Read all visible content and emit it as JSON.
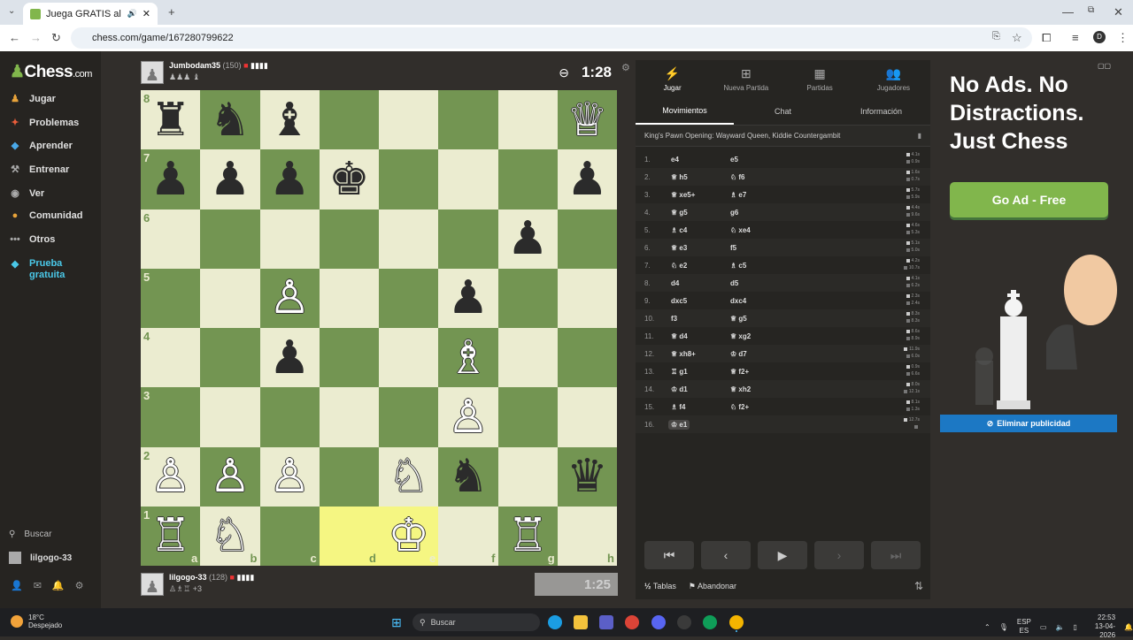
{
  "browser": {
    "tab_title": "Juega GRATIS al ajedrez onl",
    "url": "chess.com/game/167280799622",
    "profile_initial": "D"
  },
  "leftnav": {
    "logo": "Chess",
    "logo_suffix": ".com",
    "items": [
      {
        "label": "Jugar",
        "icon": "pawn-icon"
      },
      {
        "label": "Problemas",
        "icon": "puzzle-icon"
      },
      {
        "label": "Aprender",
        "icon": "learn-icon"
      },
      {
        "label": "Entrenar",
        "icon": "train-icon"
      },
      {
        "label": "Ver",
        "icon": "watch-icon"
      },
      {
        "label": "Comunidad",
        "icon": "community-icon"
      },
      {
        "label": "Otros",
        "icon": "more-icon"
      },
      {
        "label": "Prueba gratuita",
        "icon": "diamond-icon"
      }
    ],
    "search_label": "Buscar",
    "username": "lilgogo-33"
  },
  "players": {
    "top": {
      "name": "Jumbodam35",
      "rating": "(150)",
      "captured": "♟♟♟ ♝",
      "clock": "1:28"
    },
    "bottom": {
      "name": "lilgogo-33",
      "rating": "(128)",
      "captured": "♙♗♖ +3",
      "clock": "1:25"
    }
  },
  "board": {
    "pieces": {
      "a8": "♜",
      "b8": "♞",
      "c8": "♝",
      "h8": "♕",
      "a7": "♟",
      "b7": "♟",
      "c7": "♟",
      "d7": "♚",
      "h7": "♟",
      "g6": "♟",
      "c5": "♙",
      "f5": "♟",
      "c4": "♟",
      "f4": "♗",
      "f3": "♙",
      "a2": "♙",
      "b2": "♙",
      "c2": "♙",
      "e2": "♘",
      "f2": "♞",
      "h2": "♛",
      "a1": "♖",
      "b1": "♘",
      "e1": "♔",
      "g1": "♖"
    },
    "white_squares": [
      "h8",
      "c5",
      "f4",
      "f3",
      "a2",
      "b2",
      "c2",
      "e2",
      "a1",
      "b1",
      "e1",
      "g1"
    ],
    "highlight": [
      "d1",
      "e1"
    ],
    "files": [
      "a",
      "b",
      "c",
      "d",
      "e",
      "f",
      "g",
      "h"
    ],
    "ranks": [
      "8",
      "7",
      "6",
      "5",
      "4",
      "3",
      "2",
      "1"
    ]
  },
  "panel": {
    "tabs": [
      {
        "label": "Jugar",
        "icon": "play-icon"
      },
      {
        "label": "Nueva Partida",
        "icon": "plus-icon"
      },
      {
        "label": "Partidas",
        "icon": "games-icon"
      },
      {
        "label": "Jugadores",
        "icon": "players-icon"
      }
    ],
    "subtabs": [
      "Movimientos",
      "Chat",
      "Información"
    ],
    "opening": "King's Pawn Opening: Wayward Queen, Kiddie Countergambit",
    "moves": [
      {
        "n": "1.",
        "w": "e4",
        "b": "e5",
        "tw": "4.1s",
        "tb": "0.9s"
      },
      {
        "n": "2.",
        "w": "♕ h5",
        "b": "♘ f6",
        "tw": "1.6s",
        "tb": "0.7s"
      },
      {
        "n": "3.",
        "w": "♕ xe5+",
        "b": "♗ e7",
        "tw": "5.7s",
        "tb": "5.9s"
      },
      {
        "n": "4.",
        "w": "♕ g5",
        "b": "g6",
        "tw": "4.4s",
        "tb": "9.6s"
      },
      {
        "n": "5.",
        "w": "♗ c4",
        "b": "♘ xe4",
        "tw": "4.6s",
        "tb": "5.3s"
      },
      {
        "n": "6.",
        "w": "♕ e3",
        "b": "f5",
        "tw": "5.1s",
        "tb": "5.0s"
      },
      {
        "n": "7.",
        "w": "♘ e2",
        "b": "♗ c5",
        "tw": "4.2s",
        "tb": "10.7s"
      },
      {
        "n": "8.",
        "w": "d4",
        "b": "d5",
        "tw": "4.1s",
        "tb": "6.2s"
      },
      {
        "n": "9.",
        "w": "dxc5",
        "b": "dxc4",
        "tw": "2.3s",
        "tb": "2.4s"
      },
      {
        "n": "10.",
        "w": "f3",
        "b": "♕ g5",
        "tw": "8.3s",
        "tb": "8.3s"
      },
      {
        "n": "11.",
        "w": "♕ d4",
        "b": "♕ xg2",
        "tw": "8.6s",
        "tb": "8.9s"
      },
      {
        "n": "12.",
        "w": "♕ xh8+",
        "b": "♔ d7",
        "tw": "11.9s",
        "tb": "6.0s"
      },
      {
        "n": "13.",
        "w": "♖ g1",
        "b": "♕ f2+",
        "tw": "0.9s",
        "tb": "6.6s"
      },
      {
        "n": "14.",
        "w": "♔ d1",
        "b": "♕ xh2",
        "tw": "8.0s",
        "tb": "12.1s"
      },
      {
        "n": "15.",
        "w": "♗ f4",
        "b": "♘ f2+",
        "tw": "8.1s",
        "tb": "1.3s"
      },
      {
        "n": "16.",
        "w": "♔ e1",
        "b": "",
        "tw": "12.7s",
        "tb": ""
      }
    ],
    "footer": {
      "draw": "Tablas",
      "resign": "Abandonar"
    }
  },
  "ad": {
    "headline": "No Ads. No Distractions. Just Chess",
    "button": "Go Ad - Free",
    "remove": "Eliminar publicidad"
  },
  "taskbar": {
    "temp": "18°C",
    "weather": "Despejado",
    "search_placeholder": "Buscar",
    "lang1": "ESP",
    "lang2": "ES",
    "time": "22:53",
    "date": "13-04-2026"
  }
}
